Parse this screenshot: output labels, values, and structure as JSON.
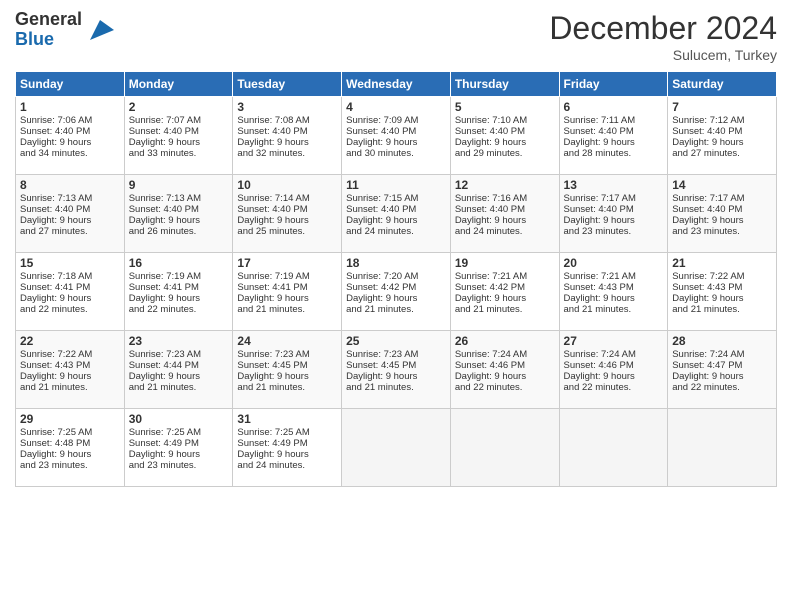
{
  "header": {
    "logo_general": "General",
    "logo_blue": "Blue",
    "month_title": "December 2024",
    "location": "Sulucem, Turkey"
  },
  "days_of_week": [
    "Sunday",
    "Monday",
    "Tuesday",
    "Wednesday",
    "Thursday",
    "Friday",
    "Saturday"
  ],
  "weeks": [
    [
      {
        "day": 1,
        "lines": [
          "Sunrise: 7:06 AM",
          "Sunset: 4:40 PM",
          "Daylight: 9 hours",
          "and 34 minutes."
        ]
      },
      {
        "day": 2,
        "lines": [
          "Sunrise: 7:07 AM",
          "Sunset: 4:40 PM",
          "Daylight: 9 hours",
          "and 33 minutes."
        ]
      },
      {
        "day": 3,
        "lines": [
          "Sunrise: 7:08 AM",
          "Sunset: 4:40 PM",
          "Daylight: 9 hours",
          "and 32 minutes."
        ]
      },
      {
        "day": 4,
        "lines": [
          "Sunrise: 7:09 AM",
          "Sunset: 4:40 PM",
          "Daylight: 9 hours",
          "and 30 minutes."
        ]
      },
      {
        "day": 5,
        "lines": [
          "Sunrise: 7:10 AM",
          "Sunset: 4:40 PM",
          "Daylight: 9 hours",
          "and 29 minutes."
        ]
      },
      {
        "day": 6,
        "lines": [
          "Sunrise: 7:11 AM",
          "Sunset: 4:40 PM",
          "Daylight: 9 hours",
          "and 28 minutes."
        ]
      },
      {
        "day": 7,
        "lines": [
          "Sunrise: 7:12 AM",
          "Sunset: 4:40 PM",
          "Daylight: 9 hours",
          "and 27 minutes."
        ]
      }
    ],
    [
      {
        "day": 8,
        "lines": [
          "Sunrise: 7:13 AM",
          "Sunset: 4:40 PM",
          "Daylight: 9 hours",
          "and 27 minutes."
        ]
      },
      {
        "day": 9,
        "lines": [
          "Sunrise: 7:13 AM",
          "Sunset: 4:40 PM",
          "Daylight: 9 hours",
          "and 26 minutes."
        ]
      },
      {
        "day": 10,
        "lines": [
          "Sunrise: 7:14 AM",
          "Sunset: 4:40 PM",
          "Daylight: 9 hours",
          "and 25 minutes."
        ]
      },
      {
        "day": 11,
        "lines": [
          "Sunrise: 7:15 AM",
          "Sunset: 4:40 PM",
          "Daylight: 9 hours",
          "and 24 minutes."
        ]
      },
      {
        "day": 12,
        "lines": [
          "Sunrise: 7:16 AM",
          "Sunset: 4:40 PM",
          "Daylight: 9 hours",
          "and 24 minutes."
        ]
      },
      {
        "day": 13,
        "lines": [
          "Sunrise: 7:17 AM",
          "Sunset: 4:40 PM",
          "Daylight: 9 hours",
          "and 23 minutes."
        ]
      },
      {
        "day": 14,
        "lines": [
          "Sunrise: 7:17 AM",
          "Sunset: 4:40 PM",
          "Daylight: 9 hours",
          "and 23 minutes."
        ]
      }
    ],
    [
      {
        "day": 15,
        "lines": [
          "Sunrise: 7:18 AM",
          "Sunset: 4:41 PM",
          "Daylight: 9 hours",
          "and 22 minutes."
        ]
      },
      {
        "day": 16,
        "lines": [
          "Sunrise: 7:19 AM",
          "Sunset: 4:41 PM",
          "Daylight: 9 hours",
          "and 22 minutes."
        ]
      },
      {
        "day": 17,
        "lines": [
          "Sunrise: 7:19 AM",
          "Sunset: 4:41 PM",
          "Daylight: 9 hours",
          "and 21 minutes."
        ]
      },
      {
        "day": 18,
        "lines": [
          "Sunrise: 7:20 AM",
          "Sunset: 4:42 PM",
          "Daylight: 9 hours",
          "and 21 minutes."
        ]
      },
      {
        "day": 19,
        "lines": [
          "Sunrise: 7:21 AM",
          "Sunset: 4:42 PM",
          "Daylight: 9 hours",
          "and 21 minutes."
        ]
      },
      {
        "day": 20,
        "lines": [
          "Sunrise: 7:21 AM",
          "Sunset: 4:43 PM",
          "Daylight: 9 hours",
          "and 21 minutes."
        ]
      },
      {
        "day": 21,
        "lines": [
          "Sunrise: 7:22 AM",
          "Sunset: 4:43 PM",
          "Daylight: 9 hours",
          "and 21 minutes."
        ]
      }
    ],
    [
      {
        "day": 22,
        "lines": [
          "Sunrise: 7:22 AM",
          "Sunset: 4:43 PM",
          "Daylight: 9 hours",
          "and 21 minutes."
        ]
      },
      {
        "day": 23,
        "lines": [
          "Sunrise: 7:23 AM",
          "Sunset: 4:44 PM",
          "Daylight: 9 hours",
          "and 21 minutes."
        ]
      },
      {
        "day": 24,
        "lines": [
          "Sunrise: 7:23 AM",
          "Sunset: 4:45 PM",
          "Daylight: 9 hours",
          "and 21 minutes."
        ]
      },
      {
        "day": 25,
        "lines": [
          "Sunrise: 7:23 AM",
          "Sunset: 4:45 PM",
          "Daylight: 9 hours",
          "and 21 minutes."
        ]
      },
      {
        "day": 26,
        "lines": [
          "Sunrise: 7:24 AM",
          "Sunset: 4:46 PM",
          "Daylight: 9 hours",
          "and 22 minutes."
        ]
      },
      {
        "day": 27,
        "lines": [
          "Sunrise: 7:24 AM",
          "Sunset: 4:46 PM",
          "Daylight: 9 hours",
          "and 22 minutes."
        ]
      },
      {
        "day": 28,
        "lines": [
          "Sunrise: 7:24 AM",
          "Sunset: 4:47 PM",
          "Daylight: 9 hours",
          "and 22 minutes."
        ]
      }
    ],
    [
      {
        "day": 29,
        "lines": [
          "Sunrise: 7:25 AM",
          "Sunset: 4:48 PM",
          "Daylight: 9 hours",
          "and 23 minutes."
        ]
      },
      {
        "day": 30,
        "lines": [
          "Sunrise: 7:25 AM",
          "Sunset: 4:49 PM",
          "Daylight: 9 hours",
          "and 23 minutes."
        ]
      },
      {
        "day": 31,
        "lines": [
          "Sunrise: 7:25 AM",
          "Sunset: 4:49 PM",
          "Daylight: 9 hours",
          "and 24 minutes."
        ]
      },
      null,
      null,
      null,
      null
    ]
  ]
}
